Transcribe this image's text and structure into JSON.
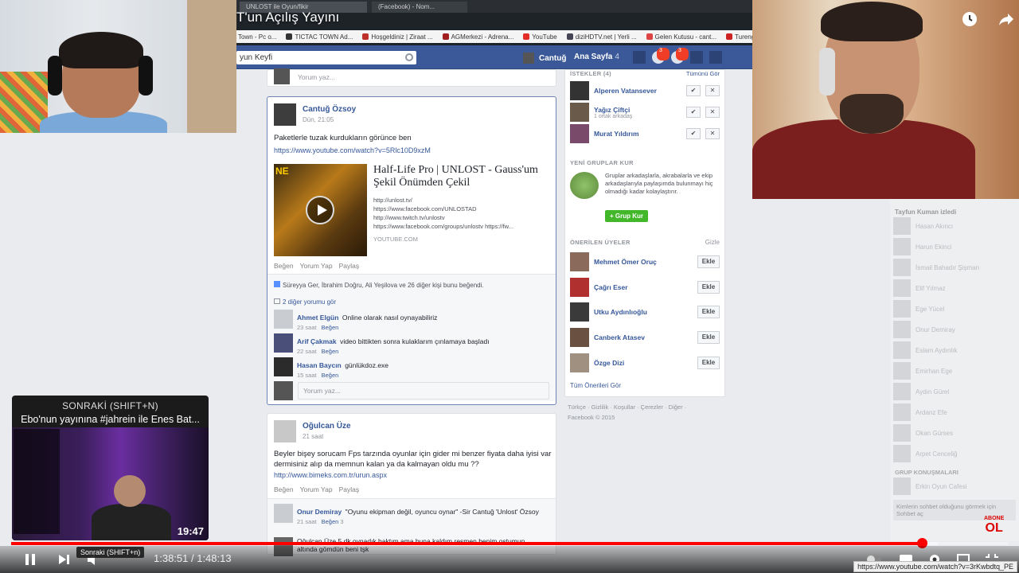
{
  "player": {
    "title": "T'un Açılış Yayını",
    "current_time": "1:38:51",
    "duration": "1:48:13",
    "time_sep": " / ",
    "played_fraction": 0.9135,
    "loaded_fraction": 0.93,
    "tooltip": "Sonraki (SHIFT+n)",
    "status_url": "https://www.youtube.com/watch?v=3rKwbdtq_PE",
    "subscribe_small": "ABONE",
    "subscribe_big": "OL"
  },
  "next_card": {
    "header": "SONRAKİ (SHIFT+N)",
    "title": "Ebo'nun yayınına #jahrein ile Enes Bat...",
    "duration": "19:47"
  },
  "browser": {
    "tabs": [
      "UNLOST ile Oyun/fikir",
      "(Facebook) - Nom..."
    ],
    "bookmarks": [
      "Town - Pc o...",
      "TICTAC TOWN Ad...",
      "Hoşgeldiniz | Ziraat ...",
      "AGMerkezi - Adrena...",
      "YouTube",
      "diziHDTV.net | Yerli ...",
      "Gelen Kutusu - cant...",
      "Tureng"
    ]
  },
  "fb": {
    "search": "yun Keyfi",
    "user": "Cantuğ",
    "home": "Ana Sayfa",
    "home_count": "4",
    "badge_msgs": "3",
    "badge_notif": "3",
    "top_comment_placeholder": "Yorum yaz...",
    "post1": {
      "author": "Cantuğ Özsoy",
      "time": "Dün, 21:05",
      "text": "Paketlerle tuzak kurdukların görünce ben",
      "url": "https://www.youtube.com/watch?v=5Rlc10D9xzM",
      "embed_title": "Half-Life Pro | UNLOST - Gauss'um Şekil Önümden Çekil",
      "embed_lines": [
        "http://unlost.tv/",
        "https://www.facebook.com/UNLOSTAD",
        "http://www.twitch.tv/unlostv",
        "https://www.facebook.com/groups/unlostv https://fw..."
      ],
      "embed_src": "YOUTUBE.COM",
      "actions": [
        "Beğen",
        "Yorum Yap",
        "Paylaş"
      ],
      "likes": "Süreyya Ger, İbrahim Doğru, Ali Yeşilova ve 26 diğer kişi bunu beğendi.",
      "more_comments": "2 diğer yorumu gör",
      "comments": [
        {
          "name": "Ahmet Elgün",
          "text": "Online olarak nasıl oynayabiliriz",
          "time": "23 saat",
          "like": "Beğen"
        },
        {
          "name": "Arif Çakmak",
          "text": "video bittikten sonra kulaklarım çınlamaya başladı",
          "time": "22 saat",
          "like": "Beğen"
        },
        {
          "name": "Hasan Baycın",
          "text": "günlükdoz.exe",
          "time": "15 saat",
          "like": "Beğen"
        }
      ],
      "reply_placeholder": "Yorum yaz..."
    },
    "post2": {
      "author": "Oğulcan Üze",
      "time": "21 saat",
      "text": "Beyler bişey sorucam Fps tarzında oyunlar için gider mi benzer fiyata daha iyisi var dermisiniz alıp da memnun kalan ya da kalmayan oldu mu ??",
      "url": "http://www.bimeks.com.tr/urun.aspx",
      "actions": [
        "Beğen",
        "Yorum Yap",
        "Paylaş"
      ],
      "comment_name": "Onur Demiray",
      "comment_text": "\"Oyunu ekipman değil, oyuncu oynar\" -Sir Cantuğ 'Unlost' Özsoy",
      "comment_time": "21 saat",
      "comment_like": "Beğen",
      "comment_count": "3",
      "comment2": "Oğulcan Üze 5 dk oynadık baktım ama buna kaldım resmen benim ostumun altında gömdün beni tşk"
    },
    "right": {
      "requests_header": "İSTEKLER (4)",
      "requests_all": "Tümünü Gör",
      "requests": [
        {
          "name": "Alperen Vatansever",
          "sub": ""
        },
        {
          "name": "Yağız Çiftçi",
          "sub": "1 ortak arkadaş"
        },
        {
          "name": "Murat Yıldırım",
          "sub": ""
        }
      ],
      "groups_header": "YENİ GRUPLAR KUR",
      "groups_text": "Gruplar arkadaşlarla, akrabalarla ve ekip arkadaşlarıyla paylaşımda bulunmayı hiç olmadığı kadar kolaylaştırır.",
      "groups_button": "+ Grup Kur",
      "suggest_header": "ÖNERİLEN ÜYELER",
      "suggest_hide": "Gizle",
      "suggestions": [
        "Mehmet Ömer Oruç",
        "Çağrı Eser",
        "Utku Aydınlıoğlu",
        "Canberk Atasev",
        "Özge Dizi"
      ],
      "add_label": "Ekle",
      "see_all": "Tüm Önerileri Gör",
      "footer": "Türkçe · Gizlilik · Koşullar · Çerezler · Diğer ·",
      "copyright": "Facebook © 2015"
    },
    "chat": {
      "top": "Tayfun Kuman izledi",
      "names": [
        "Hasan Akıncı",
        "Harun Ekinci",
        "İsmail Bahadır Şişman",
        "Elif Yılmaz",
        "Ege Yücel",
        "Onur Demiray",
        "Eslam Aydınlık",
        "Emirhan Ege",
        "Aydın Gürel",
        "Ardanz Efe",
        "Okan Gürses",
        "Arpet Cenceliğ"
      ],
      "group_chats": "GRUP KONUŞMALARI",
      "group_item": "Erkin Oyun Cafesi",
      "popup_text": "Kimlerin sohbet olduğunu görmek için Sohbet aç"
    }
  }
}
